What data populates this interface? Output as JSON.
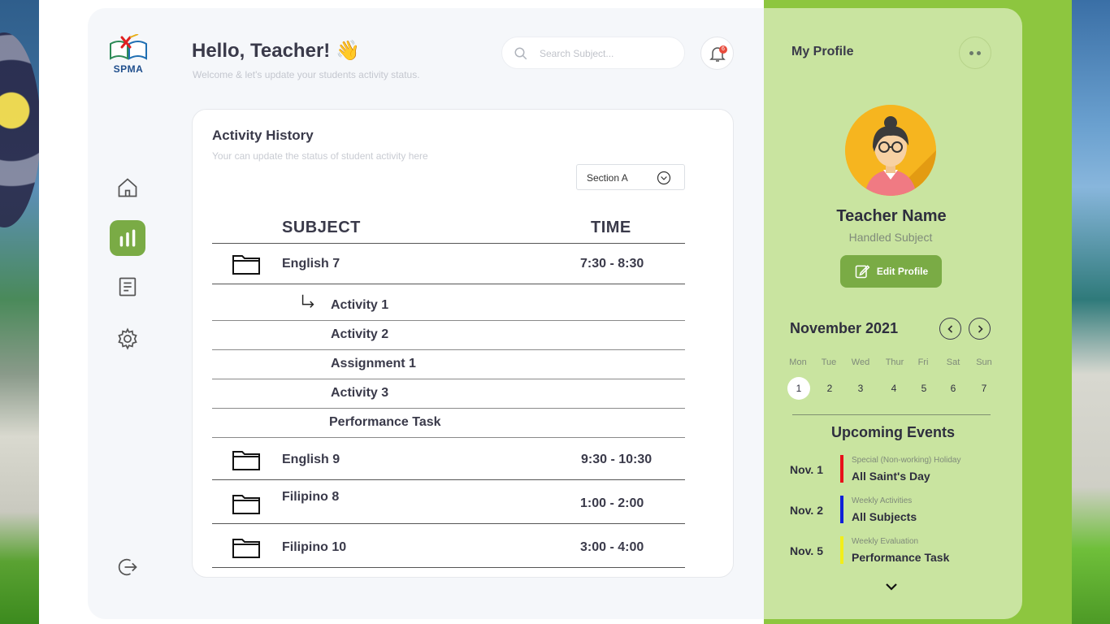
{
  "colors": {
    "accent": "#7aab45",
    "panel_green": "#c9e4a0",
    "strip_green": "#8dc63f"
  },
  "logo": {
    "text": "SPMA"
  },
  "sidebar": [
    {
      "icon": "home-icon"
    },
    {
      "icon": "chart-icon",
      "active": true
    },
    {
      "icon": "document-icon"
    },
    {
      "icon": "gear-icon"
    }
  ],
  "logout": {
    "icon": "logout-icon"
  },
  "header": {
    "greeting": "Hello, Teacher!",
    "emoji": "👋",
    "subtitle": "Welcome & let's update your students activity status.",
    "search_placeholder": "Search Subject...",
    "notif_count": "6"
  },
  "activity": {
    "title": "Activity History",
    "subtitle": "Your can update the status of student activity here",
    "section": "Section A",
    "col_subject": "SUBJECT",
    "col_time": "TIME",
    "rows": [
      {
        "subject": "English 7",
        "time": "7:30 - 8:30"
      },
      {
        "subject": "English 9",
        "time": "9:30 - 10:30"
      },
      {
        "subject": "Filipino 8",
        "time": "1:00 - 2:00"
      },
      {
        "subject": "Filipino 10",
        "time": "3:00 - 4:00"
      }
    ],
    "sub_items": [
      "Activity 1",
      "Activity 2",
      "Assignment 1",
      "Activity 3",
      "Performance Task"
    ]
  },
  "profile": {
    "title": "My Profile",
    "name": "Teacher Name",
    "handled": "Handled Subject",
    "edit_label": "Edit Profile"
  },
  "calendar": {
    "month": "November 2021",
    "days_of_week": [
      "Mon",
      "Tue",
      "Wed",
      "Thur",
      "Fri",
      "Sat",
      "Sun"
    ],
    "dates": [
      "1",
      "2",
      "3",
      "4",
      "5",
      "6",
      "7"
    ],
    "selected": "1"
  },
  "events": {
    "title": "Upcoming Events",
    "items": [
      {
        "date": "Nov. 1",
        "category": "Special (Non-working) Holiday",
        "name": "All Saint's Day",
        "color": "#e8101a"
      },
      {
        "date": "Nov. 2",
        "category": "Weekly Activities",
        "name": "All Subjects",
        "color": "#1020d8"
      },
      {
        "date": "Nov. 5",
        "category": "Weekly Evaluation",
        "name": "Performance Task",
        "color": "#f2ee1a"
      }
    ]
  }
}
